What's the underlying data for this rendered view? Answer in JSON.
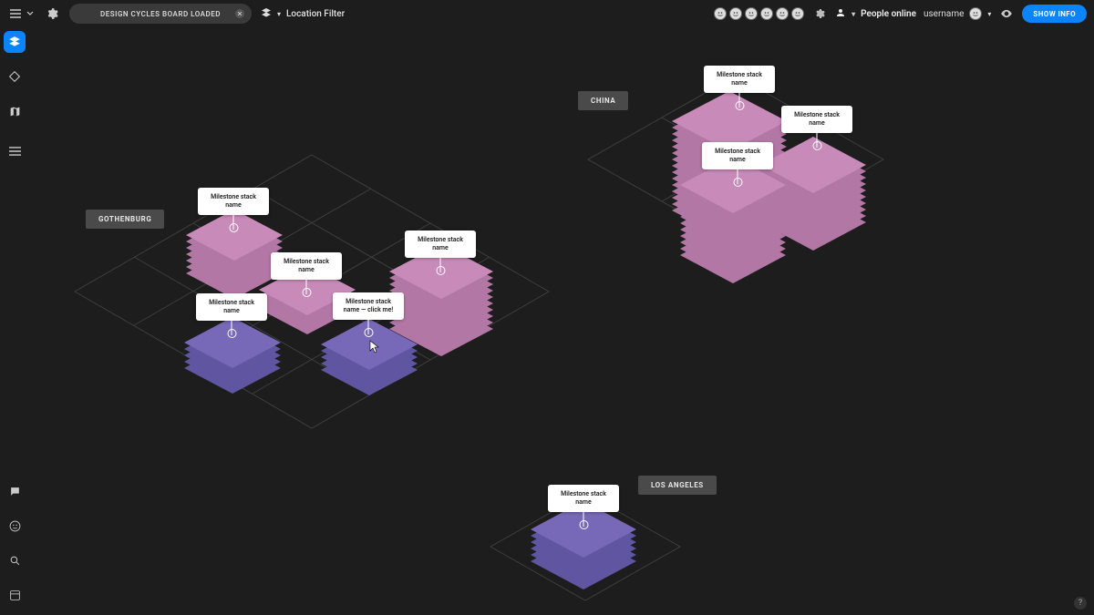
{
  "topbar": {
    "board_label": "DESIGN CYCLES BOARD LOADED",
    "filter_label": "Location Filter",
    "people_label": "People online",
    "username_label": "username",
    "show_info_label": "SHOW INFO"
  },
  "regions": {
    "gothenburg": {
      "label": "GOTHENBURG"
    },
    "china": {
      "label": "CHINA"
    },
    "los_angeles": {
      "label": "LOS ANGELES"
    }
  },
  "stacks": {
    "g1": {
      "label": "Milestone stack name"
    },
    "g2": {
      "label": "Milestone stack name"
    },
    "g3": {
      "label": "Milestone stack name"
    },
    "g4": {
      "label": "Milestone stack name"
    },
    "g5": {
      "label": "Milestone stack name — click me!"
    },
    "c1": {
      "label": "Milestone stack name"
    },
    "c2": {
      "label": "Milestone stack name"
    },
    "c3": {
      "label": "Milestone stack name"
    },
    "la1": {
      "label": "Milestone stack name"
    }
  },
  "colors": {
    "pink_top": "#c88ab9",
    "pink_side": "#b377a6",
    "purple_top": "#7868b8",
    "purple_side": "#5f55a1",
    "grid": "#3e3e3e",
    "accent": "#0a84ff"
  },
  "help_label": "?"
}
